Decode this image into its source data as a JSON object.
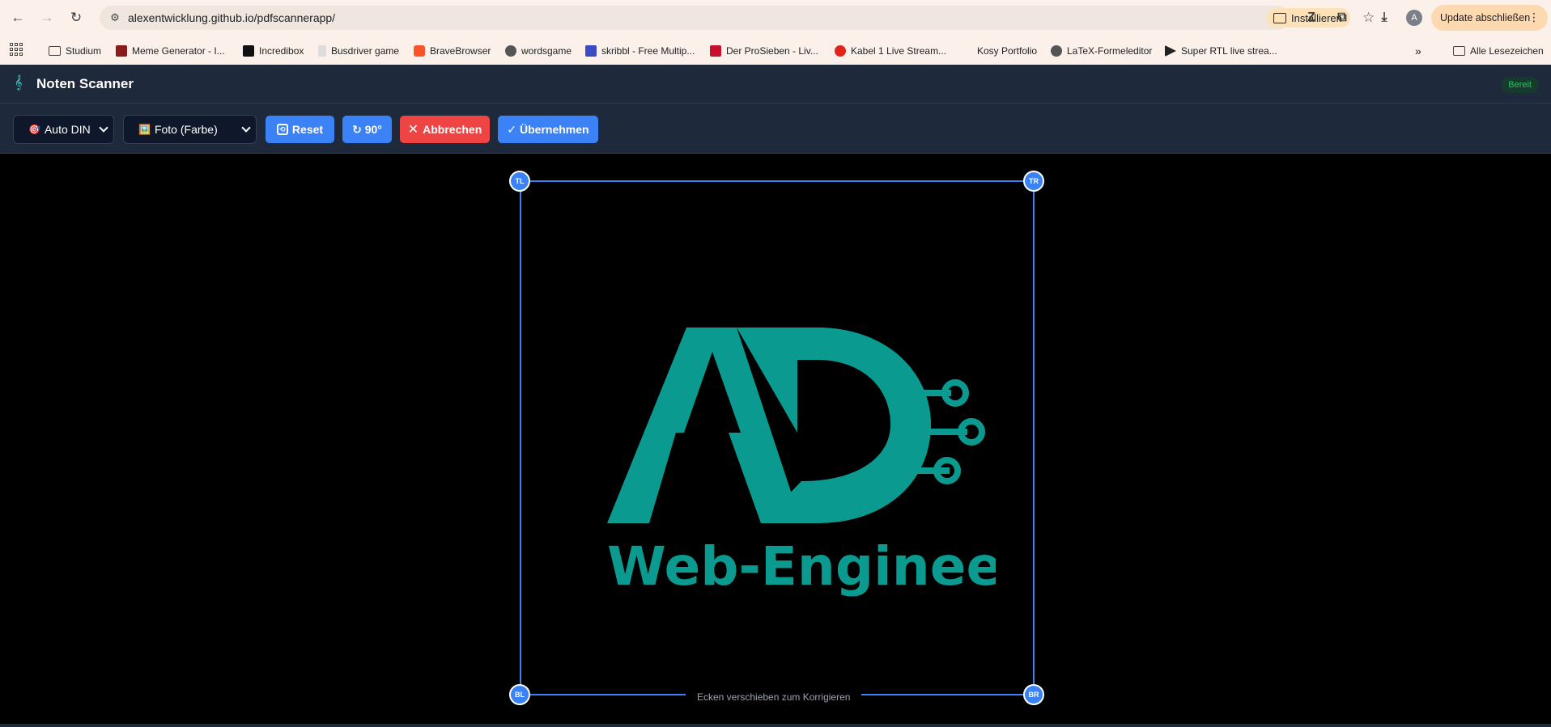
{
  "browser": {
    "url": "alexentwicklung.github.io/pdfscannerapp/",
    "install_label": "Installieren",
    "update_label": "Update abschließen",
    "avatar_letter": "A",
    "bookmarks": [
      {
        "label": "Studium",
        "icon": "folder-icon"
      },
      {
        "label": "Meme Generator - I...",
        "icon": "meme-icon"
      },
      {
        "label": "Incredibox",
        "icon": "incredibox-icon"
      },
      {
        "label": "Busdriver game",
        "icon": "page-icon"
      },
      {
        "label": "BraveBrowser",
        "icon": "brave-icon"
      },
      {
        "label": "wordsgame",
        "icon": "globe-icon"
      },
      {
        "label": "skribbl - Free Multip...",
        "icon": "skribbl-icon"
      },
      {
        "label": "Der ProSieben - Liv...",
        "icon": "prosieben-icon"
      },
      {
        "label": "Kabel 1 Live Stream...",
        "icon": "kabel1-icon"
      },
      {
        "label": "Kosy Portfolio",
        "icon": "blank-icon"
      },
      {
        "label": "LaTeX-Formeleditor",
        "icon": "globe-icon"
      },
      {
        "label": "Super RTL live strea...",
        "icon": "play-icon"
      }
    ],
    "all_bookmarks_label": "Alle Lesezeichen"
  },
  "app": {
    "title": "Noten Scanner",
    "status": "Bereit"
  },
  "toolbar": {
    "mode_select": {
      "emoji": "🎯",
      "value": "Auto DIN"
    },
    "filter_select": {
      "emoji": "🖼️",
      "value": "Foto (Farbe)"
    },
    "reset_label": "Reset",
    "rotate_label": "↻ 90°",
    "cancel_label": "Abbrechen",
    "apply_label": "✓ Übernehmen"
  },
  "canvas": {
    "logo_text_main": "AD",
    "logo_text_sub": "Web-Engineer",
    "logo_color": "#0a9a8f",
    "corners": {
      "tl": "TL",
      "tr": "TR",
      "bl": "BL",
      "br": "BR"
    },
    "hint": "Ecken verschieben zum Korrigieren"
  },
  "colors": {
    "accent": "#3b82f6",
    "danger": "#ef4444",
    "header_bg": "#1e293b",
    "status_green": "#22c55e"
  }
}
